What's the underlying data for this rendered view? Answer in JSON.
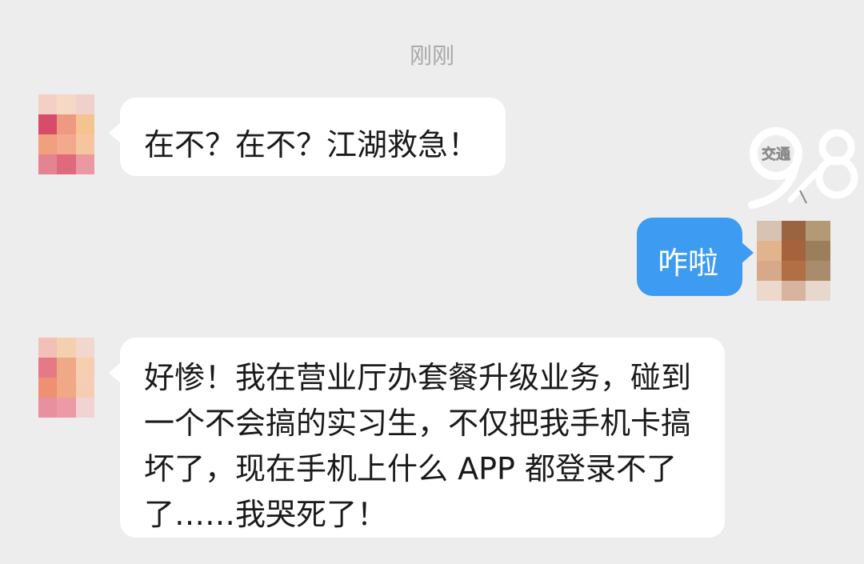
{
  "timestamp": "刚刚",
  "messages": [
    {
      "side": "left",
      "text": "在不？在不？江湖救急！"
    },
    {
      "side": "right",
      "text": "咋啦"
    },
    {
      "side": "left",
      "text": "好惨！我在营业厅办套餐升级业务，碰到一个不会搞的实习生，不仅把我手机卡搞坏了，现在手机上什么 APP 都登录不了了……我哭死了！"
    }
  ],
  "watermark": {
    "badge": "交通",
    "digits_left": "9",
    "digits_right": "8"
  },
  "colors": {
    "background": "#ededed",
    "bubble_left": "#ffffff",
    "bubble_right": "#3d9cf2",
    "timestamp": "#a8a8a8"
  }
}
